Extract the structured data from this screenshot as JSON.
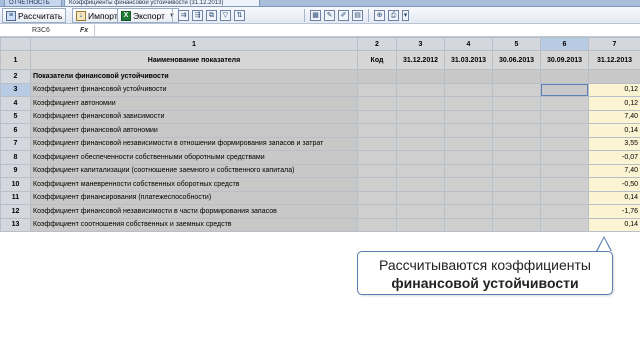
{
  "tabs": {
    "first": "ОТЧЕТНОСТЬ",
    "second": "Коэффициенты финансовой устойчивости (31.12.2013)"
  },
  "toolbar": {
    "recalc_label": "Рассчитать",
    "import_label": "Импорт",
    "export_label": "Экспорт",
    "icons": [
      "insert-row-icon",
      "delete-row-icon",
      "copy-icon",
      "filter-icon",
      "sort-icon",
      "table-icon",
      "edit-icon",
      "edit-cell-icon",
      "calculator-icon",
      "zoom-icon",
      "print-icon"
    ]
  },
  "formula_bar": {
    "cell_ref": "R3C6",
    "fx_label": "Fx",
    "value": ""
  },
  "grid": {
    "column_numbers": [
      "1",
      "2",
      "3",
      "4",
      "5",
      "6",
      "7"
    ],
    "headers": [
      "Наименование показателя",
      "Код",
      "31.12.2012",
      "31.03.2013",
      "30.06.2013",
      "30.09.2013",
      "31.12.2013"
    ],
    "section_title": "Показатели финансовой устойчивости",
    "rows": [
      {
        "num": "3",
        "label": "Коэффициент финансовой устойчивости",
        "value": "0,12"
      },
      {
        "num": "4",
        "label": "Коэффициент автономии",
        "value": "0,12"
      },
      {
        "num": "5",
        "label": "Коэффициент финансовой зависимости",
        "value": "7,40"
      },
      {
        "num": "6",
        "label": "Коэффициент финансовой автономии",
        "value": "0,14"
      },
      {
        "num": "7",
        "label": "Коэффициент финансовой независимости в отношении формирования запасов и затрат",
        "value": "3,55"
      },
      {
        "num": "8",
        "label": "Коэффициент обеспеченности собственными оборотными средствами",
        "value": "-0,07"
      },
      {
        "num": "9",
        "label": "Коэффициент капитализации (соотношение заемного и собственного капитала)",
        "value": "7,40"
      },
      {
        "num": "10",
        "label": "Коэффициент маневренности собственных оборотных средств",
        "value": "-0,50"
      },
      {
        "num": "11",
        "label": "Коэффициент финансирования (платежеспособности)",
        "value": "0,14"
      },
      {
        "num": "12",
        "label": "Коэффициент финансовой независимости в части формирования запасов",
        "value": "-1,76"
      },
      {
        "num": "13",
        "label": "Коэффициент соотношения собственных и заемных средств",
        "value": "0,14"
      }
    ]
  },
  "callout": {
    "line1": "Рассчитываются коэффициенты",
    "line2": "финансовой устойчивости"
  },
  "colors": {
    "value_cell_bg": "#fbf4d2",
    "selection_accent": "#5c7fb5",
    "callout_border": "#5a7fb0"
  }
}
